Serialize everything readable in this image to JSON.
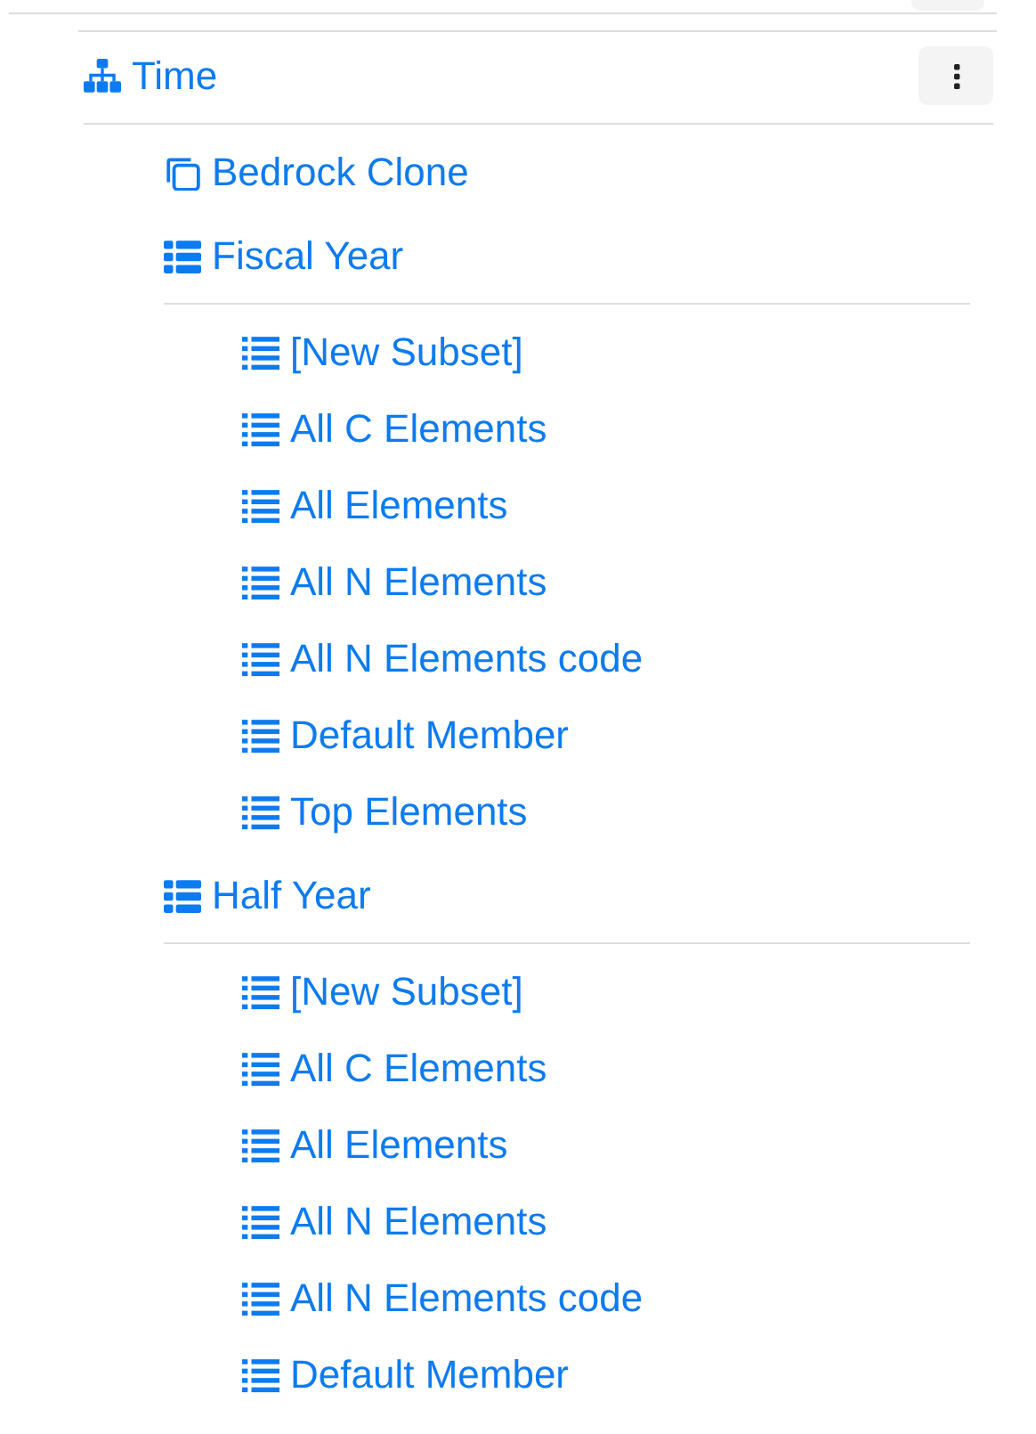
{
  "tree": [
    {
      "kind": "dimension",
      "label": "Time",
      "menu": true,
      "children": [
        {
          "kind": "clone",
          "label": "Bedrock Clone"
        },
        {
          "kind": "hierarchy",
          "label": "Fiscal Year",
          "children": [
            {
              "kind": "subset",
              "label": "[New Subset]"
            },
            {
              "kind": "subset",
              "label": "All C Elements"
            },
            {
              "kind": "subset",
              "label": "All Elements"
            },
            {
              "kind": "subset",
              "label": "All N Elements"
            },
            {
              "kind": "subset",
              "label": "All N Elements code"
            },
            {
              "kind": "subset",
              "label": "Default Member"
            },
            {
              "kind": "subset",
              "label": "Top Elements"
            }
          ]
        },
        {
          "kind": "hierarchy",
          "label": "Half Year",
          "children": [
            {
              "kind": "subset",
              "label": "[New Subset]"
            },
            {
              "kind": "subset",
              "label": "All C Elements"
            },
            {
              "kind": "subset",
              "label": "All Elements"
            },
            {
              "kind": "subset",
              "label": "All N Elements"
            },
            {
              "kind": "subset",
              "label": "All N Elements code"
            },
            {
              "kind": "subset",
              "label": "Default Member"
            }
          ]
        }
      ]
    }
  ]
}
